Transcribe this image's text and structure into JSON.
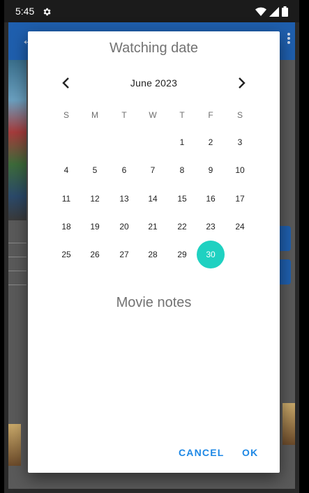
{
  "status_bar": {
    "time": "5:45",
    "icons": [
      "gear-icon",
      "wifi-icon",
      "signal-icon",
      "battery-icon"
    ]
  },
  "dialog": {
    "title": "Watching date",
    "month_label": "June 2023",
    "weekdays": [
      "S",
      "M",
      "T",
      "W",
      "T",
      "F",
      "S"
    ],
    "weeks": [
      [
        "",
        "",
        "",
        "",
        "1",
        "2",
        "3"
      ],
      [
        "4",
        "5",
        "6",
        "7",
        "8",
        "9",
        "10"
      ],
      [
        "11",
        "12",
        "13",
        "14",
        "15",
        "16",
        "17"
      ],
      [
        "18",
        "19",
        "20",
        "21",
        "22",
        "23",
        "24"
      ],
      [
        "25",
        "26",
        "27",
        "28",
        "29",
        "30",
        ""
      ]
    ],
    "selected_day": "30",
    "notes_label": "Movie notes",
    "cancel_label": "CANCEL",
    "ok_label": "OK"
  },
  "colors": {
    "accent": "#1fd1c1",
    "action": "#1e88e5",
    "app_bar": "#1f5fae"
  }
}
